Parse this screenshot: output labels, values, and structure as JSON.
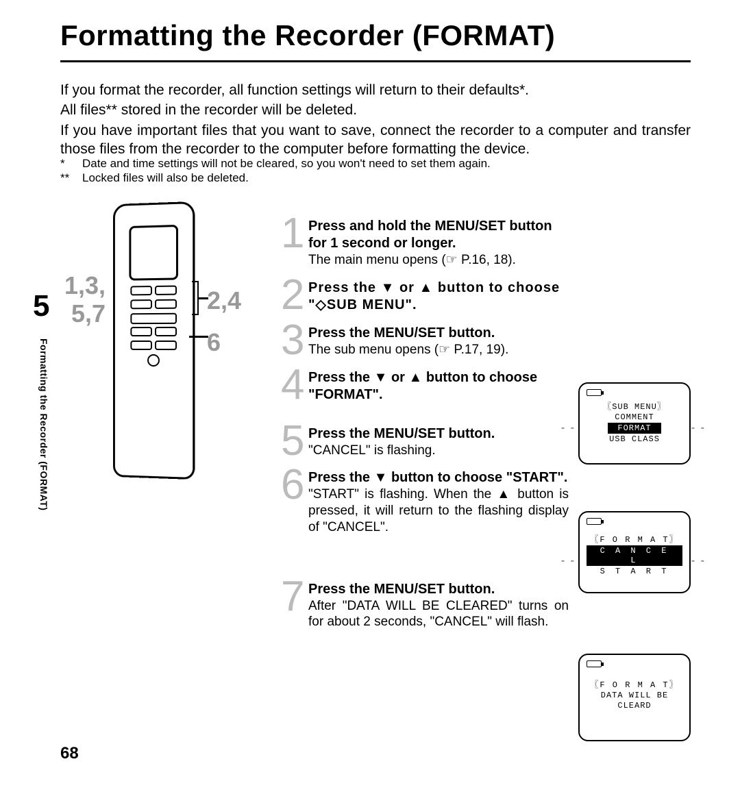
{
  "title": "Formatting the Recorder (FORMAT)",
  "intro": {
    "p1": "If you format the recorder, all function settings will return to their defaults*.",
    "p2": "All files** stored in the recorder will be deleted.",
    "p3": "If you have important files that you want to save, connect the recorder to a computer and transfer those files from the recorder to the computer before formatting the device."
  },
  "notes": {
    "n1_star": "*",
    "n1_text": "Date and time settings will not be cleared, so you won't need to set them again.",
    "n2_star": "**",
    "n2_text": "Locked files will also be deleted."
  },
  "chapter_num": "5",
  "sidebar_label": "Formatting the Recorder (FORMAT)",
  "page_num": "68",
  "callouts": {
    "left_line1": "1,3,",
    "left_line2": "5,7",
    "right_line1": "2,4",
    "right_line2": "6"
  },
  "steps": [
    {
      "num": "1",
      "bold_a": "Press and hold the ",
      "btn": "MENU/SET",
      "bold_b": " button for 1 second or longer.",
      "note": "The main menu opens (☞ P.16, 18)."
    },
    {
      "num": "2",
      "bold_a": "Press the ▼ or ▲ button to choose \"◇SUB MENU\".",
      "btn": "",
      "bold_b": "",
      "note": ""
    },
    {
      "num": "3",
      "bold_a": "Press the ",
      "btn": "MENU/SET",
      "bold_b": "  button.",
      "note": "The sub menu opens (☞ P.17, 19)."
    },
    {
      "num": "4",
      "bold_a": "Press the ▼ or ▲ button to choose \"FORMAT\".",
      "btn": "",
      "bold_b": "",
      "note": ""
    },
    {
      "num": "5",
      "bold_a": "Press the ",
      "btn": "MENU/SET",
      "bold_b": "  button.",
      "note": "\"CANCEL\" is flashing."
    },
    {
      "num": "6",
      "bold_a": "Press the ▼ button to choose \"START\".",
      "btn": "",
      "bold_b": "",
      "note": "\"START\" is flashing. When the ▲ button is pressed, it will return to the flashing display of \"CANCEL\"."
    },
    {
      "num": "7",
      "bold_a": "Press the ",
      "btn": "MENU/SET",
      "bold_b": " button.",
      "note": "After \"DATA WILL BE CLEARED\" turns on for about 2 seconds, \"CANCEL\" will flash."
    }
  ],
  "lcd1": {
    "header": "〖SUB MENU〗",
    "line1": "COMMENT",
    "line2_hl": "FORMAT",
    "line3": "USB CLASS"
  },
  "lcd2": {
    "header": "〖F O R M A T〗",
    "line1_hl": "C A N C E L",
    "line2": "S T A R T"
  },
  "lcd3": {
    "header": "〖F O R M A T〗",
    "line1": "DATA WILL BE",
    "line2": "CLEARD"
  }
}
